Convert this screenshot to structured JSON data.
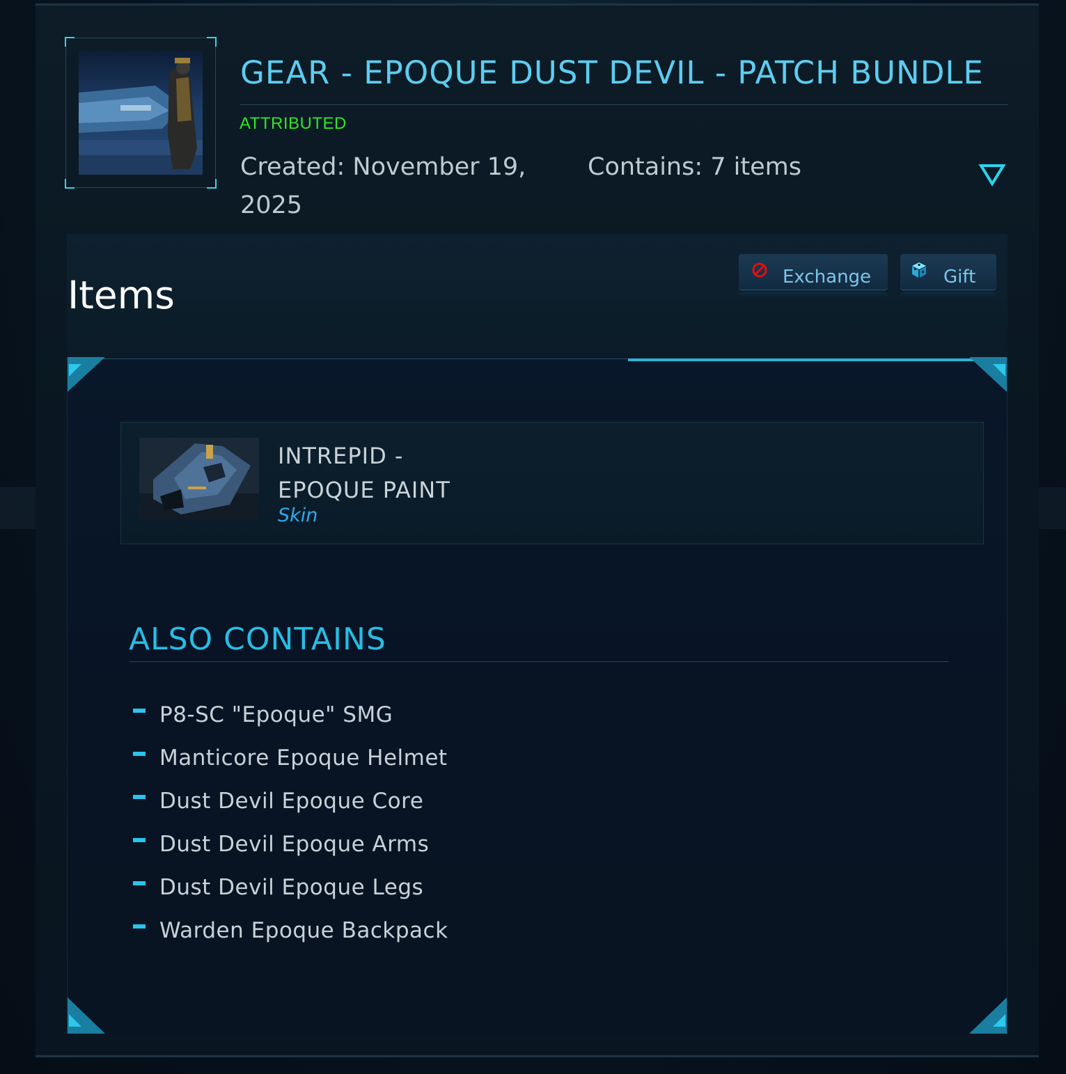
{
  "header": {
    "title": "GEAR - EPOQUE DUST DEVIL - PATCH BUNDLE",
    "status": "ATTRIBUTED",
    "created": "Created: November 19, 2025",
    "contains": "Contains: 7 items"
  },
  "items_section": {
    "heading": "Items",
    "exchange_label": "Exchange",
    "gift_label": "Gift"
  },
  "featured_item": {
    "name": "INTREPID - EPOQUE PAINT",
    "type": "Skin"
  },
  "also_contains": {
    "heading": "ALSO CONTAINS",
    "items": [
      "P8-SC \"Epoque\" SMG",
      "Manticore Epoque Helmet",
      "Dust Devil Epoque Core",
      "Dust Devil Epoque Arms",
      "Dust Devil Epoque Legs",
      "Warden Epoque Backpack"
    ]
  },
  "colors": {
    "title": "#5ccdf0",
    "status": "#2ee626",
    "accent": "#28c5ee",
    "item_type": "#2eaaee",
    "exchange_icon": "#e01010"
  },
  "icons": {
    "expand": "chevron-down-triangle-icon",
    "exchange": "prohibited-icon",
    "gift": "gift-box-icon"
  }
}
